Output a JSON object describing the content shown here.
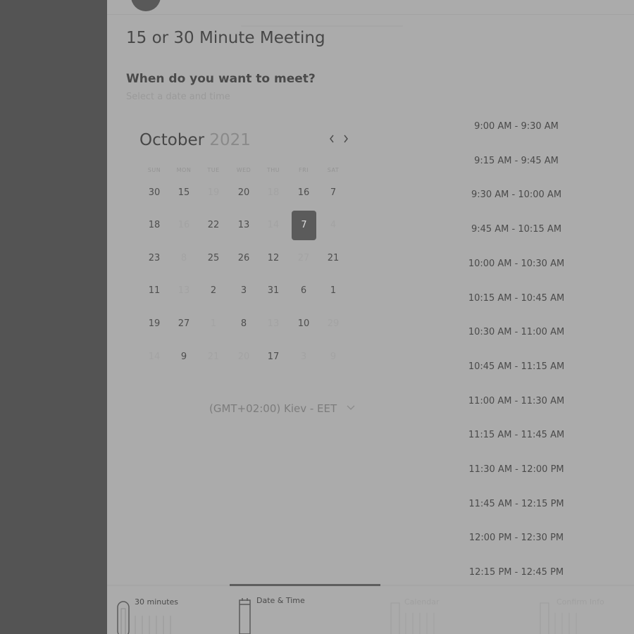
{
  "meeting": {
    "title": "15 or 30 Minute Meeting",
    "question": "When do you want to meet?",
    "subquestion": "Select a date and time"
  },
  "calendar": {
    "month": "October",
    "year": "2021",
    "prev_icon": "chevron-left-icon",
    "next_icon": "chevron-right-icon",
    "weekdays": [
      "SUN",
      "MON",
      "TUE",
      "WED",
      "THU",
      "FRI",
      "SAT"
    ],
    "weeks": [
      [
        {
          "d": "30",
          "m": false
        },
        {
          "d": "15",
          "m": false
        },
        {
          "d": "19",
          "m": true
        },
        {
          "d": "20",
          "m": false
        },
        {
          "d": "18",
          "m": true
        },
        {
          "d": "16",
          "m": false
        },
        {
          "d": "7",
          "m": false
        }
      ],
      [
        {
          "d": "18",
          "m": false
        },
        {
          "d": "16",
          "m": true
        },
        {
          "d": "22",
          "m": false
        },
        {
          "d": "13",
          "m": false
        },
        {
          "d": "14",
          "m": true
        },
        {
          "d": "7",
          "m": false,
          "s": true
        },
        {
          "d": "4",
          "m": true
        }
      ],
      [
        {
          "d": "23",
          "m": false
        },
        {
          "d": "8",
          "m": true
        },
        {
          "d": "25",
          "m": false
        },
        {
          "d": "26",
          "m": false
        },
        {
          "d": "12",
          "m": false
        },
        {
          "d": "27",
          "m": true
        },
        {
          "d": "21",
          "m": false
        }
      ],
      [
        {
          "d": "11",
          "m": false
        },
        {
          "d": "13",
          "m": true
        },
        {
          "d": "2",
          "m": false
        },
        {
          "d": "3",
          "m": false
        },
        {
          "d": "31",
          "m": false
        },
        {
          "d": "6",
          "m": false
        },
        {
          "d": "1",
          "m": false
        }
      ],
      [
        {
          "d": "19",
          "m": false
        },
        {
          "d": "27",
          "m": false
        },
        {
          "d": "1",
          "m": true
        },
        {
          "d": "8",
          "m": false
        },
        {
          "d": "13",
          "m": true
        },
        {
          "d": "10",
          "m": false
        },
        {
          "d": "29",
          "m": true
        }
      ],
      [
        {
          "d": "14",
          "m": true
        },
        {
          "d": "9",
          "m": false
        },
        {
          "d": "21",
          "m": true
        },
        {
          "d": "20",
          "m": true
        },
        {
          "d": "17",
          "m": false
        },
        {
          "d": "3",
          "m": true
        },
        {
          "d": "9",
          "m": true
        }
      ]
    ],
    "selected_day": "7"
  },
  "timezone": {
    "label": "(GMT+02:00) Kiev - EET",
    "icon": "chevron-down-icon"
  },
  "time_slots": [
    "9:00 AM - 9:30 AM",
    "9:15 AM - 9:45 AM",
    "9:30 AM - 10:00 AM",
    "9:45 AM - 10:15 AM",
    "10:00 AM - 10:30 AM",
    "10:15 AM - 10:45 AM",
    "10:30 AM - 11:00 AM",
    "10:45 AM - 11:15 AM",
    "11:00 AM - 11:30 AM",
    "11:15 AM - 11:45 AM",
    "11:30 AM - 12:00 PM",
    "11:45 AM - 12:15 PM",
    "12:00 PM - 12:30 PM",
    "12:15 PM - 12:45 PM"
  ],
  "steps": [
    {
      "label": "30 minutes",
      "icon": "clock-icon",
      "active": true
    },
    {
      "label": "Date & Time",
      "icon": "calendar-icon",
      "active": true
    },
    {
      "label": "Calendar",
      "icon": "calendar-icon",
      "active": false
    },
    {
      "label": "Confirm Info",
      "icon": "user-icon",
      "active": false
    }
  ],
  "colors": {
    "sidebar": "#545454",
    "background": "#ababab",
    "selected_day": "#5b5b5b",
    "progress": "#5e5e5e"
  }
}
